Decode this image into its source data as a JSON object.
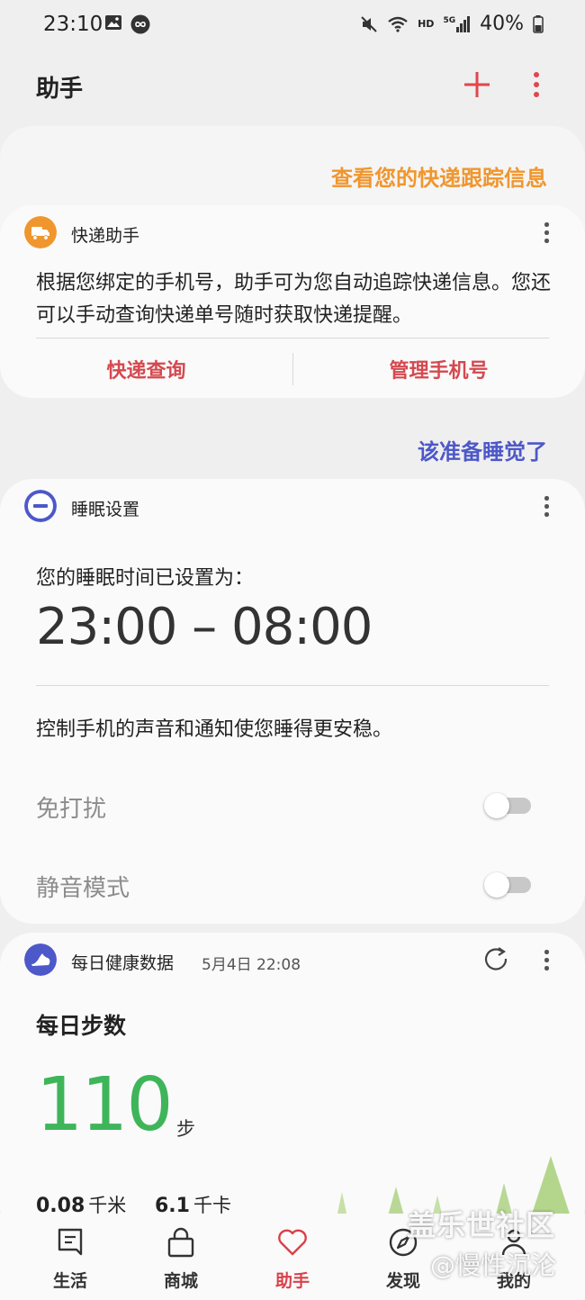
{
  "status_bar": {
    "time": "23:10",
    "network": "HD",
    "signal_type": "5G",
    "battery": "40%"
  },
  "header": {
    "title": "助手"
  },
  "package": {
    "section_title": "查看您的快递跟踪信息",
    "card_title": "快递助手",
    "description": "根据您绑定的手机号，助手可为您自动追踪快递信息。您还可以手动查询快递单号随时获取快递提醒。",
    "actions": [
      "快递查询",
      "管理手机号"
    ]
  },
  "sleep": {
    "section_title": "该准备睡觉了",
    "card_title": "睡眠设置",
    "label": "您的睡眠时间已设置为：",
    "time_range": "23:00 – 08:00",
    "note": "控制手机的声音和通知使您睡得更安稳。",
    "toggles": [
      {
        "label": "免打扰",
        "enabled": false
      },
      {
        "label": "静音模式",
        "enabled": false
      }
    ]
  },
  "health": {
    "card_title": "每日健康数据",
    "timestamp": "5月4日 22:08",
    "steps_title": "每日步数",
    "steps": "110",
    "steps_unit": "步",
    "distance": "0.08",
    "distance_unit": "千米",
    "calories": "6.1",
    "calories_unit": "千卡"
  },
  "nav": [
    {
      "label": "生活",
      "icon": "bookmark-icon",
      "active": false
    },
    {
      "label": "商城",
      "icon": "shopping-bag-icon",
      "active": false
    },
    {
      "label": "助手",
      "icon": "heart-icon",
      "active": true
    },
    {
      "label": "发现",
      "icon": "compass-icon",
      "active": false
    },
    {
      "label": "我的",
      "icon": "person-icon",
      "active": false
    }
  ],
  "watermark": {
    "line1": "盖乐世社区",
    "line2": "@慢性沉沦"
  },
  "colors": {
    "accent_red": "#e2454c",
    "package_orange": "#f0962e",
    "sleep_blue": "#4d58c9",
    "health_green": "#3fb55a",
    "nav_active": "#d9414b"
  }
}
